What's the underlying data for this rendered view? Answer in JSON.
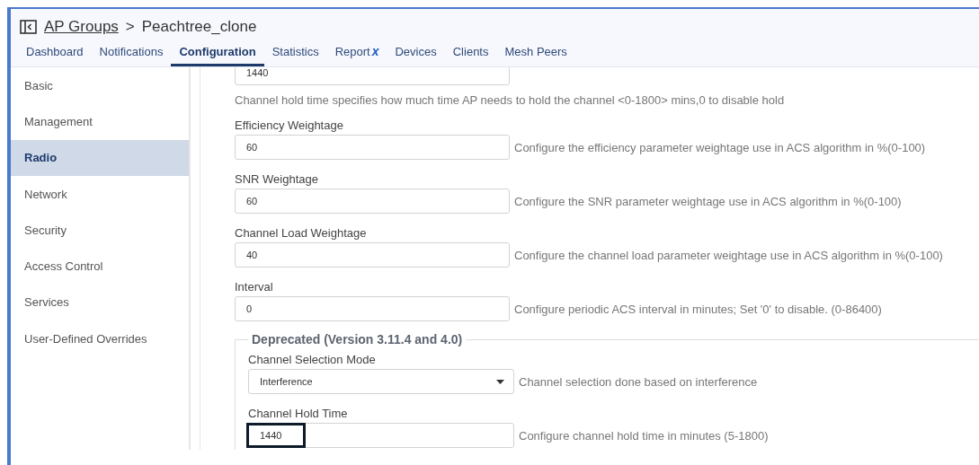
{
  "header": {
    "parent": "AP Groups",
    "separator": ">",
    "current": "Peachtree_clone"
  },
  "tabs": [
    {
      "label": "Dashboard",
      "selected": false
    },
    {
      "label": "Notifications",
      "selected": false
    },
    {
      "label": "Configuration",
      "selected": true
    },
    {
      "label": "Statistics",
      "selected": false
    },
    {
      "label": "Report",
      "selected": false,
      "badge": "x"
    },
    {
      "label": "Devices",
      "selected": false
    },
    {
      "label": "Clients",
      "selected": false
    },
    {
      "label": "Mesh Peers",
      "selected": false
    }
  ],
  "sidebar": {
    "items": [
      {
        "label": "Basic",
        "selected": false
      },
      {
        "label": "Management",
        "selected": false
      },
      {
        "label": "Radio",
        "selected": true
      },
      {
        "label": "Network",
        "selected": false
      },
      {
        "label": "Security",
        "selected": false
      },
      {
        "label": "Access Control",
        "selected": false
      },
      {
        "label": "Services",
        "selected": false
      },
      {
        "label": "User-Defined Overrides",
        "selected": false
      }
    ]
  },
  "top_field": {
    "value": "1440",
    "help": "Channel hold time specifies how much time AP needs to hold the channel <0-1800> mins,0 to disable hold"
  },
  "fields": [
    {
      "label": "Efficiency Weightage",
      "value": "60",
      "help": "Configure the efficiency parameter weightage use in ACS algorithm in %(0-100)"
    },
    {
      "label": "SNR Weightage",
      "value": "60",
      "help": "Configure the SNR parameter weightage use in ACS algorithm in %(0-100)"
    },
    {
      "label": "Channel Load Weightage",
      "value": "40",
      "help": "Configure the channel load parameter weightage use in ACS algorithm in %(0-100)"
    },
    {
      "label": "Interval",
      "value": "0",
      "help": "Configure periodic ACS interval in minutes; Set '0' to disable. (0-86400)"
    }
  ],
  "deprecated": {
    "legend": "Deprecated (Version 3.11.4 and 4.0)",
    "fields": [
      {
        "kind": "select",
        "label": "Channel Selection Mode",
        "value": "Interference",
        "help": "Channel selection done based on interference",
        "focused": false
      },
      {
        "kind": "input",
        "label": "Channel Hold Time",
        "value": "1440",
        "help": "Configure channel hold time in minutes (5-1800)",
        "focused": true
      }
    ]
  }
}
